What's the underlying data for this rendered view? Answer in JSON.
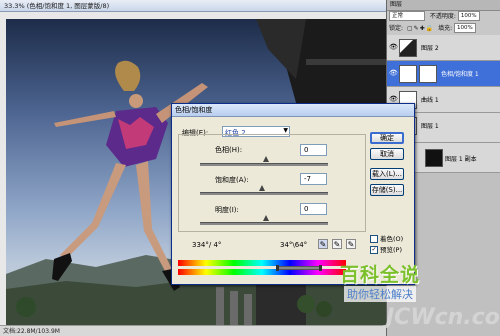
{
  "window": {
    "title": "33.3% (色相/饱和度 1, 图层蒙版/8)",
    "status": "文档:22.8M/103.9M"
  },
  "layers_panel": {
    "tab": "图层",
    "blend_mode": "正常",
    "opacity_label": "不透明度:",
    "opacity": "100%",
    "fill_label": "填充:",
    "fill": "100%",
    "lock_label": "锁定:",
    "layers": [
      {
        "name": "图层 2",
        "selected": false
      },
      {
        "name": "色相/饱和度 1",
        "selected": true
      },
      {
        "name": "曲线 1",
        "selected": false
      },
      {
        "name": "图层 1",
        "selected": false
      },
      {
        "name": "图层 1 副本",
        "selected": false
      }
    ]
  },
  "dialog": {
    "title": "色相/饱和度",
    "edit_label": "编辑(E):",
    "edit_value": "红色 2",
    "hue_label": "色相(H):",
    "hue_value": "0",
    "saturation_label": "饱和度(A):",
    "saturation_value": "-7",
    "lightness_label": "明度(I):",
    "lightness_value": "0",
    "range_left": "334°/ 4°",
    "range_right": "34°\\64°",
    "ok": "确定",
    "cancel": "取消",
    "load": "载入(L)...",
    "save": "存储(S)...",
    "colorize_label": "着色(O)",
    "colorize_checked": false,
    "preview_label": "预览(P)",
    "preview_checked": true,
    "saturation_level": -7
  },
  "watermark": {
    "main": "百科全说",
    "sub": "助你轻松解决",
    "site": "JCWcn.com"
  },
  "colors": {
    "accent": "#3f6fd8",
    "dialog_bg": "#ece9d8",
    "watermark_green": "#7cc02c",
    "watermark_blue": "#4c7ec9"
  }
}
